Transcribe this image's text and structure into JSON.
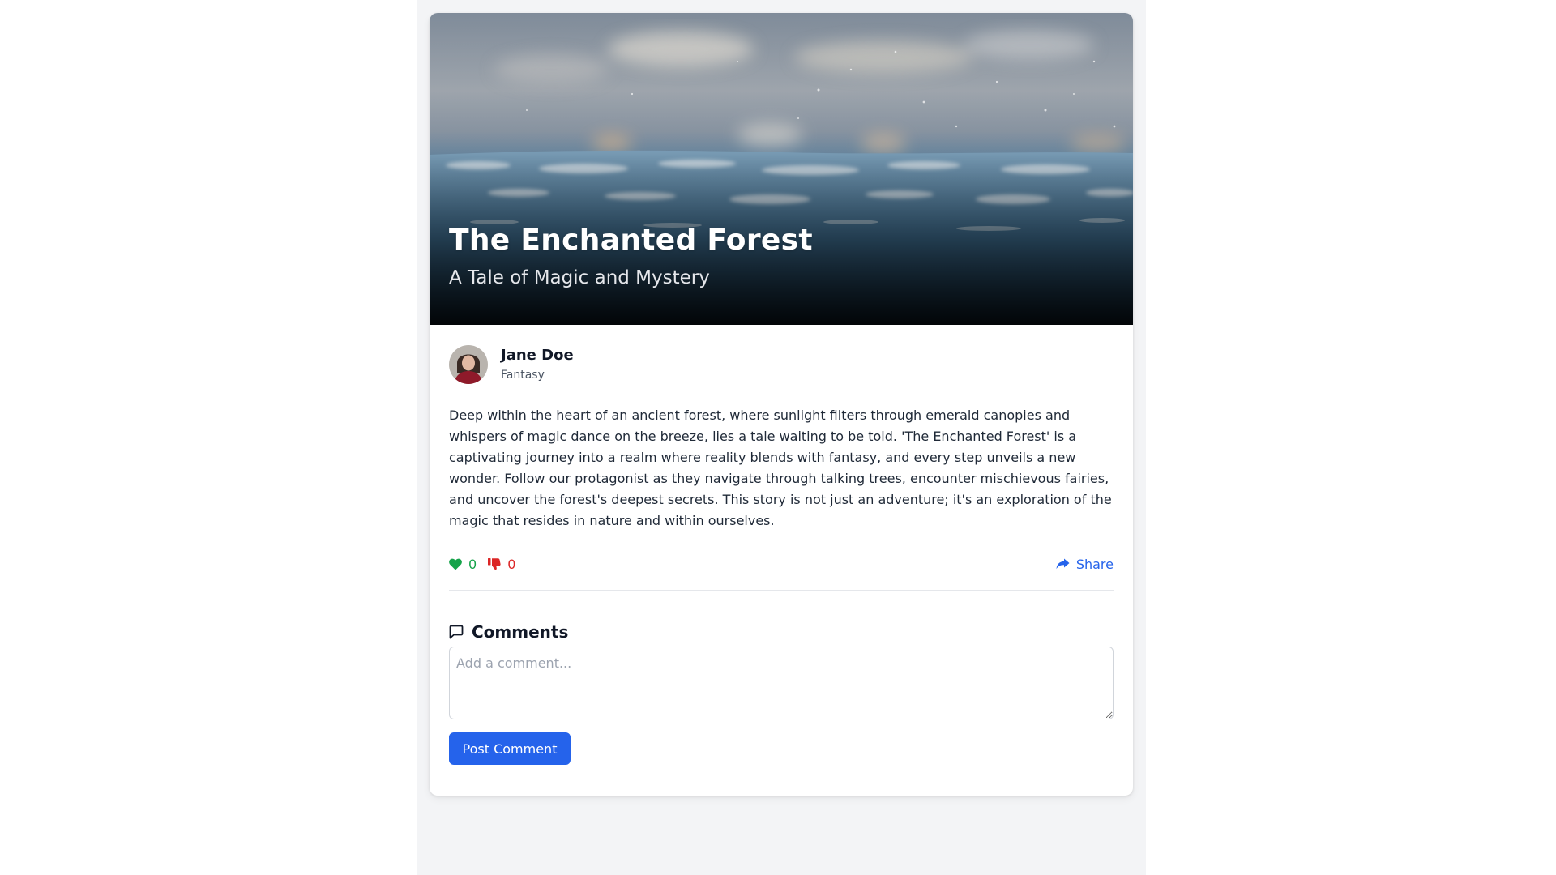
{
  "story": {
    "title": "The Enchanted Forest",
    "subtitle": "A Tale of Magic and Mystery",
    "hero_image": "rain-on-water-photo",
    "author": {
      "name": "Jane Doe",
      "genre": "Fantasy",
      "avatar": "author-avatar-photo"
    },
    "body": "Deep within the heart of an ancient forest, where sunlight filters through emerald canopies and whispers of magic dance on the breeze, lies a tale waiting to be told. 'The Enchanted Forest' is a captivating journey into a realm where reality blends with fantasy, and every step unveils a new wonder. Follow our protagonist as they navigate through talking trees, encounter mischievous fairies, and uncover the forest's deepest secrets. This story is not just an adventure; it's an exploration of the magic that resides in nature and within ourselves."
  },
  "actions": {
    "likes": "0",
    "dislikes": "0",
    "share_label": "Share",
    "like_icon": "heart-icon",
    "dislike_icon": "thumbs-down-icon",
    "share_icon": "share-arrow-icon"
  },
  "comments": {
    "heading": "Comments",
    "heading_icon": "comment-icon",
    "input_value": "",
    "placeholder": "Add a comment...",
    "post_label": "Post Comment"
  },
  "colors": {
    "like": "#16a34a",
    "dislike": "#dc2626",
    "accent": "#2563eb",
    "page_background": "#f3f4f6"
  }
}
